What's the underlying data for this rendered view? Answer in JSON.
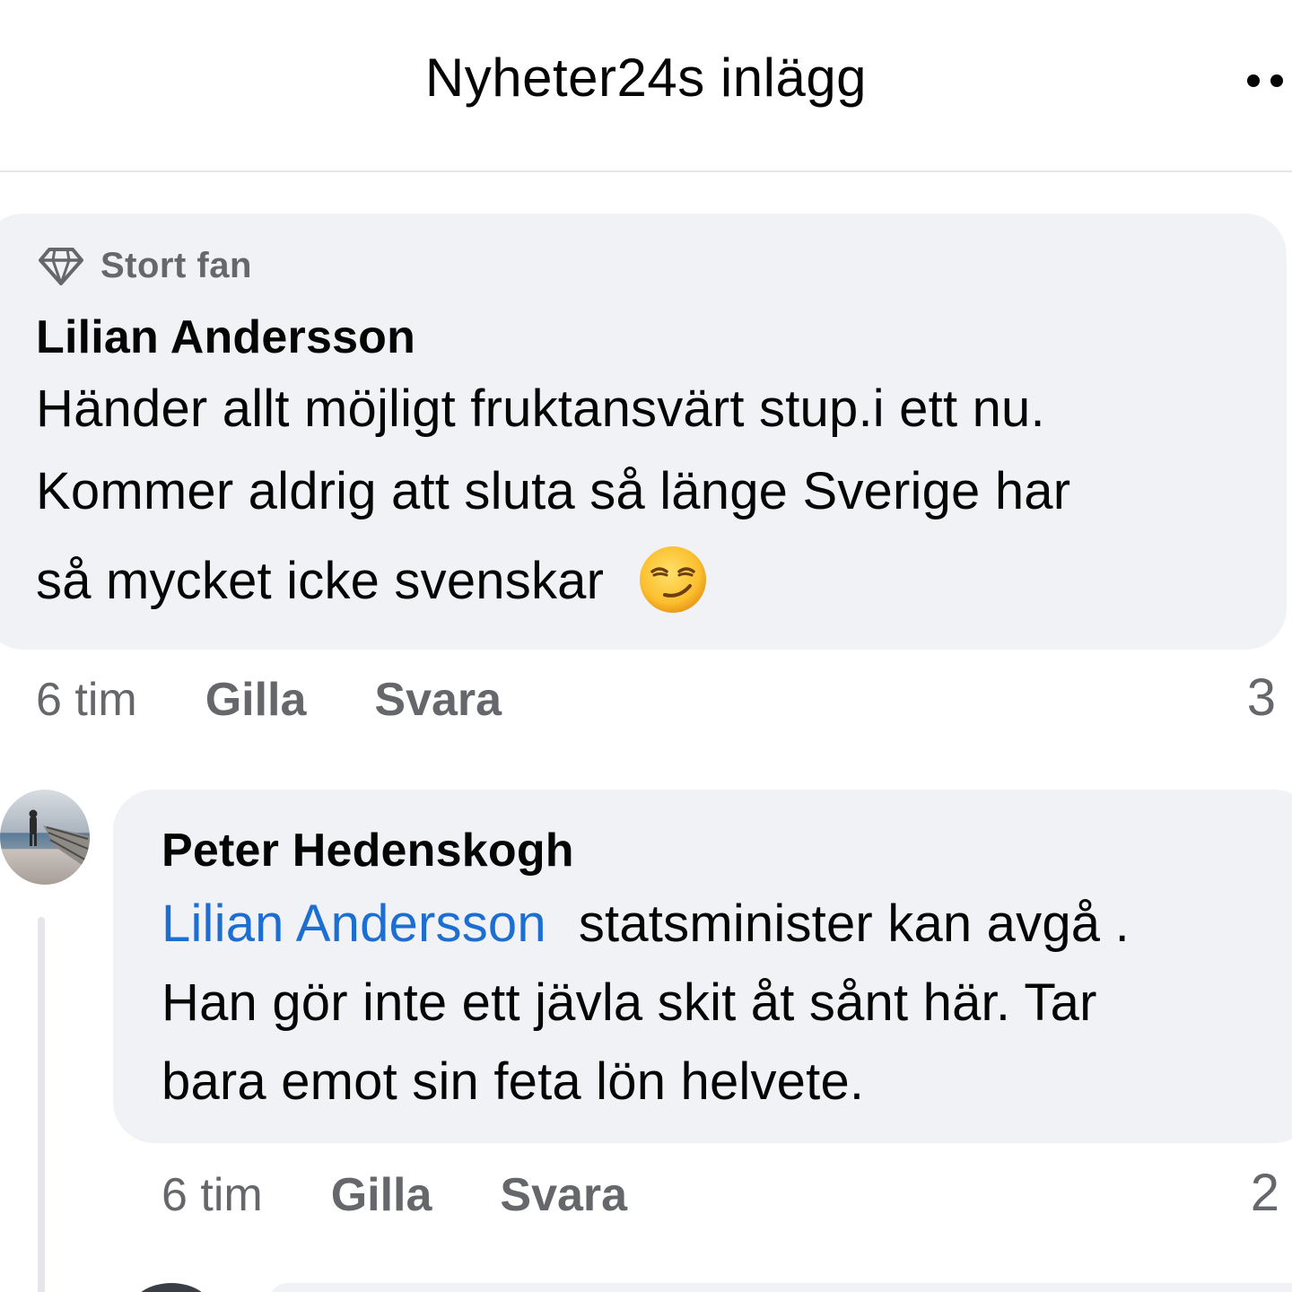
{
  "header": {
    "title": "Nyheter24s inlägg",
    "more_icon": "more-dots-icon"
  },
  "comments": [
    {
      "badge_icon": "diamond-icon",
      "badge_label": "Stort fan",
      "author": "Lilian Andersson",
      "lines": [
        "Händer allt möjligt fruktansvärt stup.i ett nu.",
        "Kommer aldrig att sluta så länge  Sverige har",
        "så mycket icke svenskar"
      ],
      "emoji_icon": "smirking-face-emoji",
      "time": "6 tim",
      "like_label": "Gilla",
      "reply_label": "Svara",
      "reaction_count": "3"
    },
    {
      "author": "Peter Hedenskogh",
      "mention": "Lilian Andersson",
      "first_line_rest": "statsminister kan avgå .",
      "lines": [
        "Han gör inte ett jävla skit åt sånt här. Tar",
        "bara emot sin feta lön helvete."
      ],
      "time": "6 tim",
      "like_label": "Gilla",
      "reply_label": "Svara",
      "reaction_count": "2"
    }
  ],
  "colors": {
    "bubble": "#f0f2f5",
    "secondary_text": "#65676b",
    "mention": "#1d6ed2",
    "primary_text": "#050505"
  }
}
